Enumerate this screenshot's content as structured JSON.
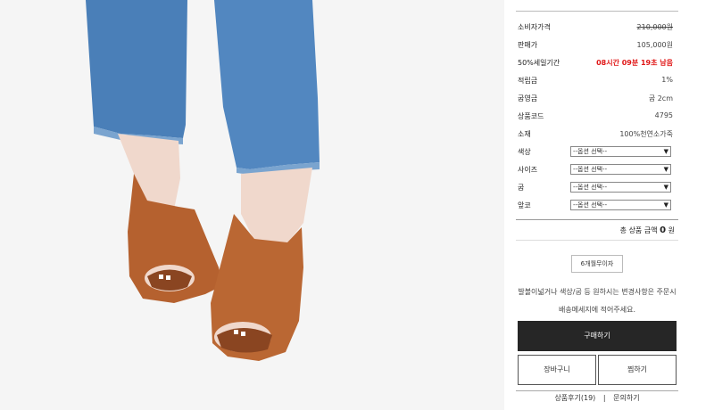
{
  "product": {
    "photo_alt": "product-photo",
    "rows": [
      {
        "label": "소비자가격",
        "value": "210,000원"
      },
      {
        "label": "판매가",
        "value": "105,000원"
      },
      {
        "label": "50%세일기간",
        "value": "08시간 09분 19초 남음"
      },
      {
        "label": "적립금",
        "value": "1%"
      },
      {
        "label": "굽영금",
        "value": "굽 2cm"
      },
      {
        "label": "상품코드",
        "value": "4795"
      },
      {
        "label": "소재",
        "value": "100%천연소가죽"
      }
    ],
    "options": [
      {
        "label": "색상",
        "value": "--옵션 선택--"
      },
      {
        "label": "사이즈",
        "value": "--옵션 선택--"
      },
      {
        "label": "굽",
        "value": "--옵션 선택--"
      },
      {
        "label": "앞코",
        "value": "--옵션 선택--"
      }
    ],
    "total_prefix": "총 상품 금액",
    "total_amount": "0",
    "total_unit": "원",
    "installment": "6개월무이자",
    "notice_line1": "발볼이넓거나 색상/굽 등 원하시는 변경사항은 주문시",
    "notice_line2": "배송메세지에 적어주세요.",
    "buy_label": "구매하기",
    "cart_label": "장바구니",
    "wish_label": "찜하기",
    "review_label": "상품후기(19)",
    "qna_label": "문의하기",
    "divider": "|"
  },
  "colors": {
    "accent_red": "#e01818",
    "buy_bg": "#262626",
    "shoe": "#b5612f",
    "denim": "#4a7fb8"
  },
  "icons": {
    "select_arrow": "chevron-down-icon"
  }
}
